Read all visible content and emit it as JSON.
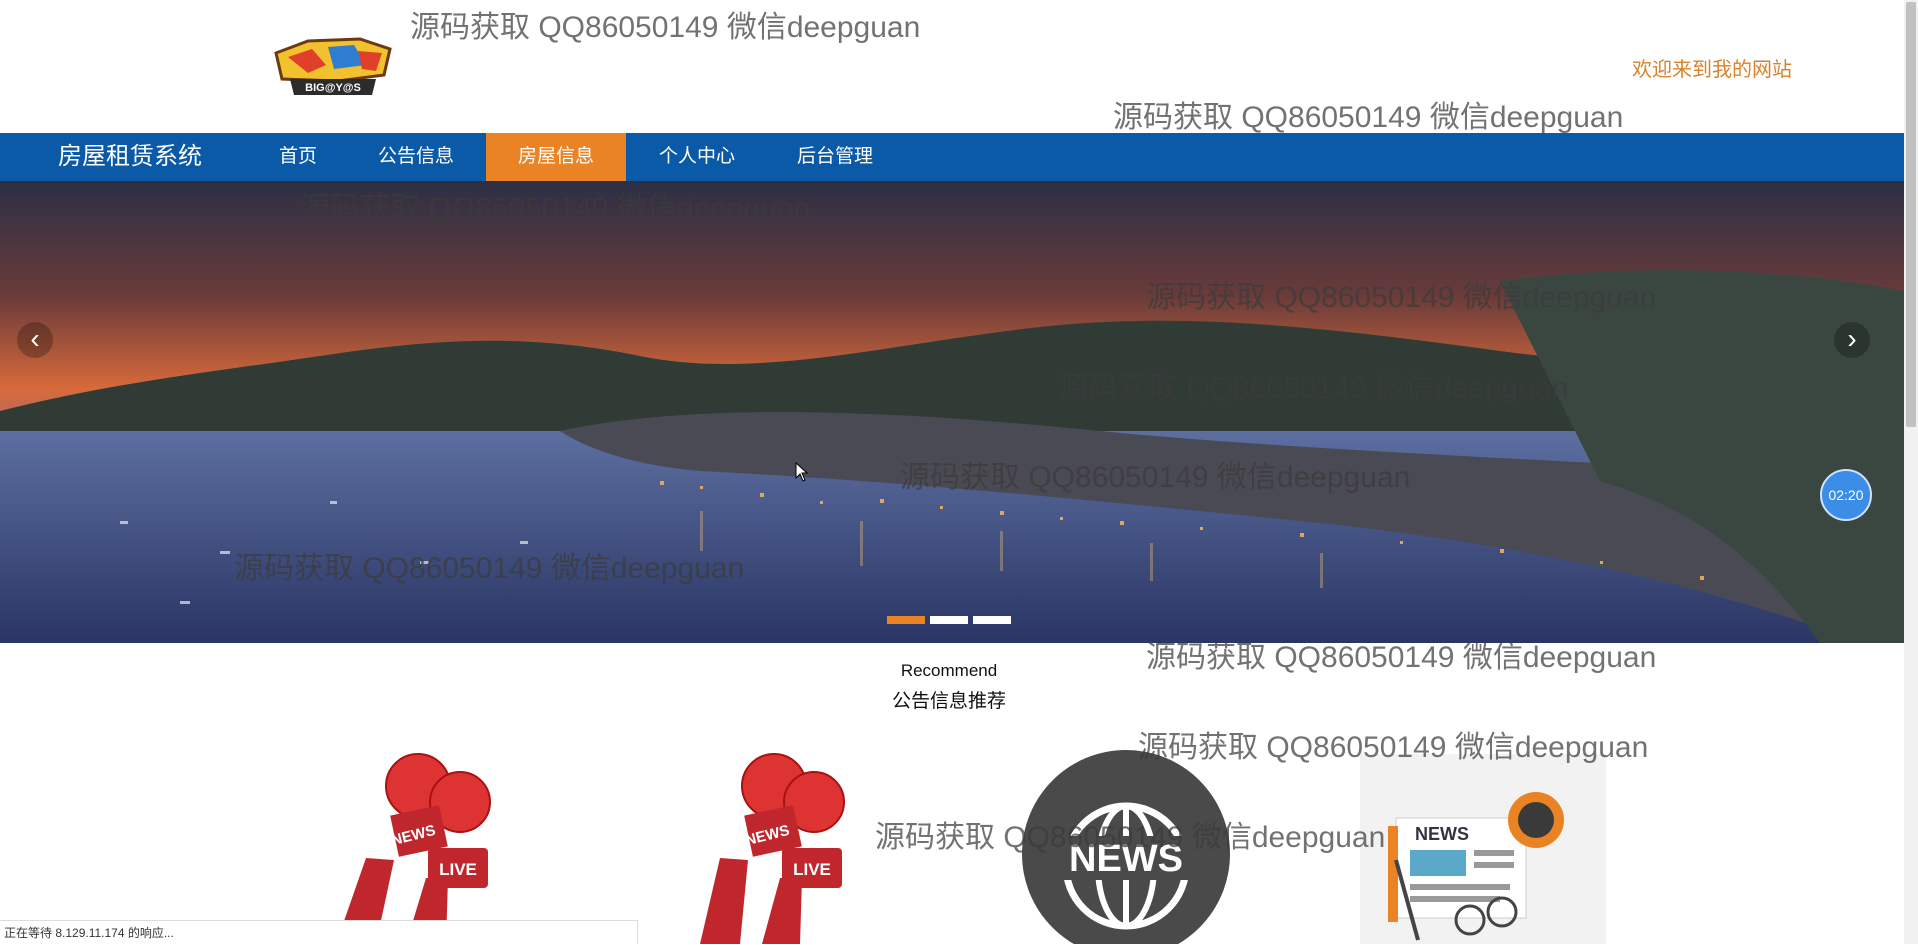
{
  "header": {
    "logo_text": "BIG@Y@S",
    "welcome": "欢迎来到我的网站"
  },
  "nav": {
    "site_title": "房屋租赁系统",
    "items": [
      {
        "label": "首页"
      },
      {
        "label": "公告信息"
      },
      {
        "label": "房屋信息"
      },
      {
        "label": "个人中心"
      },
      {
        "label": "后台管理"
      }
    ]
  },
  "carousel": {
    "prev_icon": "chevron-left",
    "next_icon": "chevron-right",
    "active_index": 0,
    "slide_count": 3,
    "timer": "02:20"
  },
  "recommend": {
    "title_en": "Recommend",
    "title_cn": "公告信息推荐"
  },
  "cards": [
    {
      "icon": "news-live-microphone",
      "label": "NEWS",
      "badge": "LIVE"
    },
    {
      "icon": "news-live-microphone",
      "label": "NEWS",
      "badge": "LIVE"
    },
    {
      "icon": "news-globe",
      "label": "NEWS"
    },
    {
      "icon": "newspaper-coffee-glasses",
      "label": "NEWS"
    }
  ],
  "watermark": "源码获取 QQ86050149 微信deepguan",
  "status_bar": "正在等待 8.129.11.174 的响应...",
  "colors": {
    "nav_bg": "#0a5aa8",
    "accent": "#e98324",
    "welcome": "#d9822b"
  }
}
